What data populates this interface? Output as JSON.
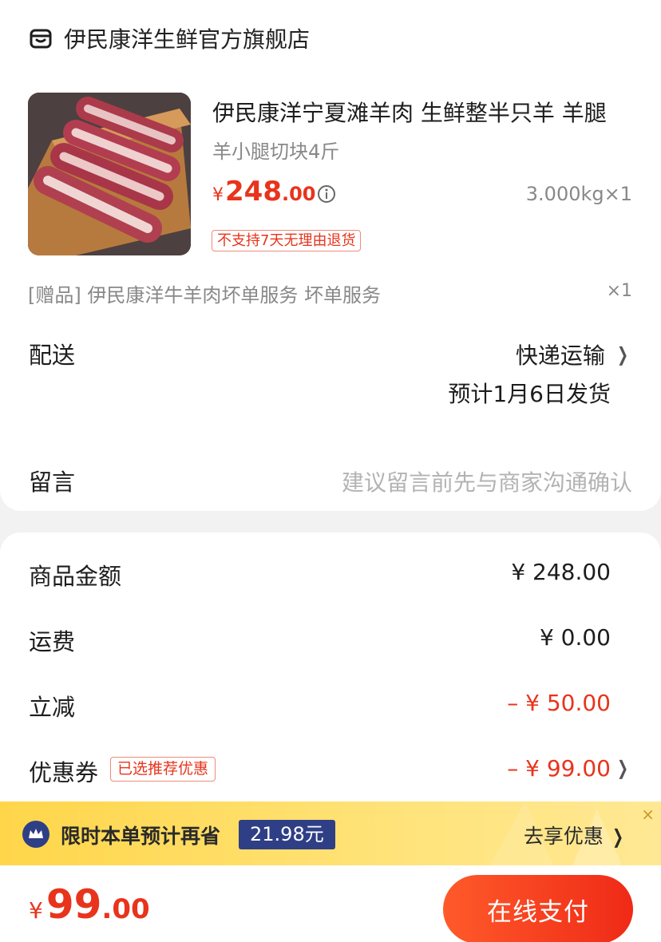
{
  "shop": {
    "name": "伊民康洋生鲜官方旗舰店",
    "icon": "store-icon"
  },
  "product": {
    "title": "伊民康洋宁夏滩羊肉 生鲜整半只羊 羊腿",
    "spec": "羊小腿切块4斤",
    "price_currency": "¥",
    "price_int": "248",
    "price_dec": ".00",
    "quantity": "3.000kg×1",
    "return_tag": "不支持7天无理由退货",
    "image_desc_icon": "lamb-shank-image"
  },
  "gift": {
    "text": "[赠品] 伊民康洋牛羊肉坏单服务 坏单服务",
    "qty": "×1"
  },
  "delivery": {
    "label": "配送",
    "method": "快递运输",
    "estimate": "预计1月6日发货"
  },
  "message": {
    "label": "留言",
    "placeholder": "建议留言前先与商家沟通确认"
  },
  "summary": {
    "goods_label": "商品金额",
    "goods_amount": "¥ 248.00",
    "shipping_label": "运费",
    "shipping_amount": "¥ 0.00",
    "discount_label": "立减",
    "discount_amount": "– ¥ 50.00",
    "coupon_label": "优惠券",
    "coupon_tag": "已选推荐优惠",
    "coupon_amount": "– ¥ 99.00"
  },
  "promo": {
    "text": "限时本单预计再省",
    "badge": "21.98元",
    "link": "去享优惠",
    "close": "×"
  },
  "footer": {
    "currency": "¥",
    "total_int": "99",
    "total_dec": ".00",
    "pay_label": "在线支付"
  },
  "colors": {
    "accent_red": "#e8341c",
    "promo_yellow": "#ffd64a",
    "badge_navy": "#2f3f86"
  }
}
